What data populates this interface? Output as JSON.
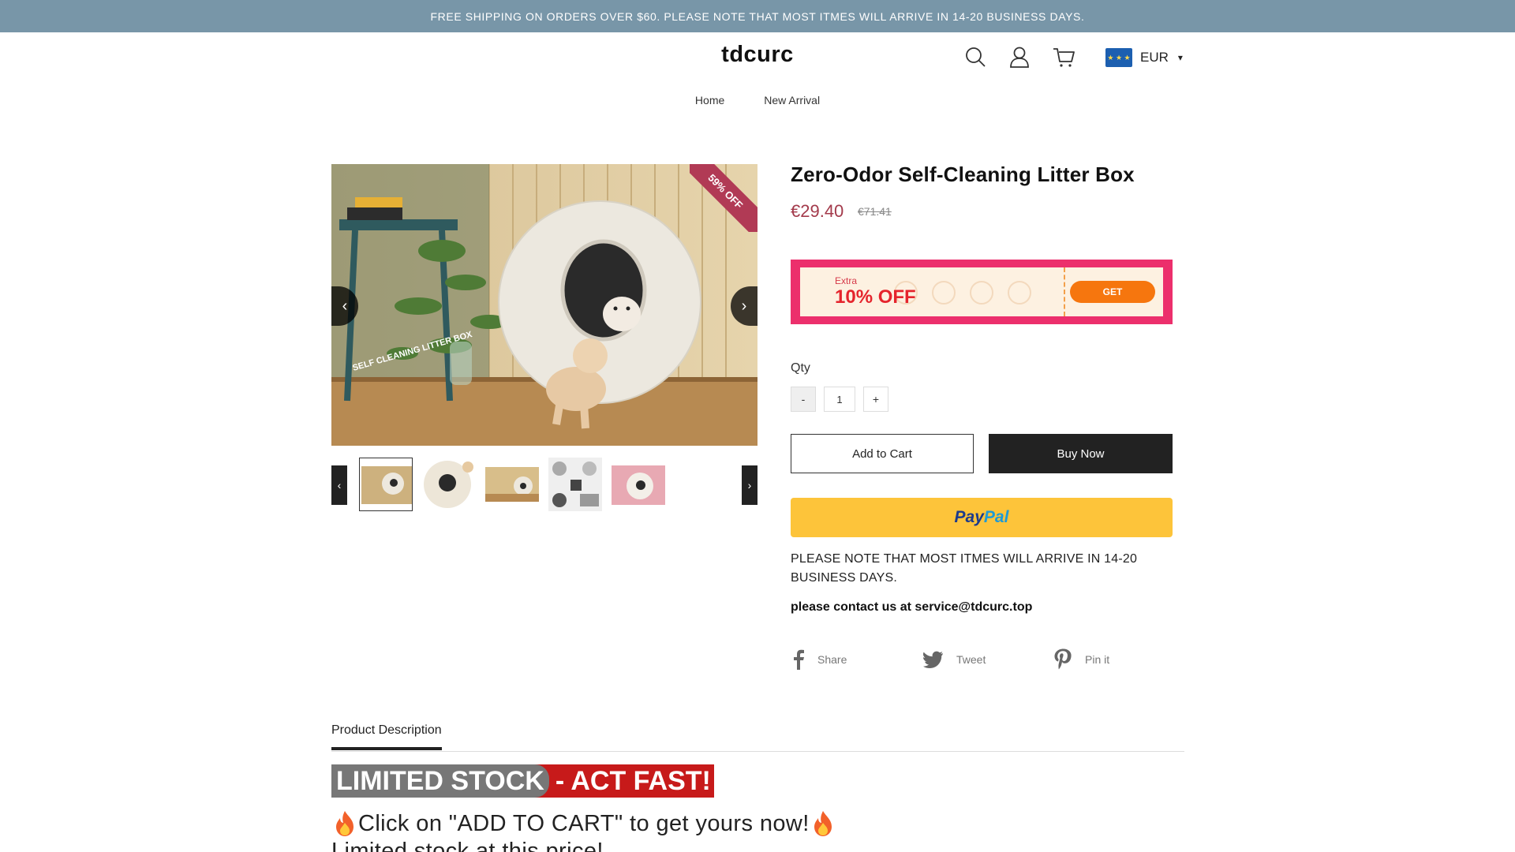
{
  "announcement": "FREE SHIPPING ON ORDERS OVER $60. PLEASE NOTE THAT MOST ITMES WILL ARRIVE IN 14-20 BUSINESS DAYS.",
  "header": {
    "logo": "tdcurc",
    "icons": [
      "search-icon",
      "user-icon",
      "cart-icon"
    ],
    "currency": {
      "label": "EUR",
      "flag": "eu-flag"
    }
  },
  "nav": {
    "items": [
      "Home",
      "New Arrival"
    ]
  },
  "product": {
    "title": "Zero-Odor Self-Cleaning Litter Box",
    "price": "€29.40",
    "compare_price": "€71.41",
    "badge": "59% OFF",
    "image_text": "SELF CLEANING LITTER BOX",
    "coupon": {
      "extra": "Extra",
      "discount": "10% OFF",
      "button": "GET"
    },
    "qty": {
      "label": "Qty",
      "minus": "-",
      "value": "1",
      "plus": "+"
    },
    "add_to_cart": "Add to Cart",
    "buy_now": "Buy Now",
    "paypal": {
      "part1": "Pay",
      "part2": "Pal"
    },
    "notice": "PLEASE NOTE THAT MOST ITMES WILL ARRIVE IN 14-20 BUSINESS DAYS.",
    "contact": "please contact us at service@tdcurc.top",
    "share": {
      "facebook": "Share",
      "twitter": "Tweet",
      "pinterest": "Pin it"
    }
  },
  "description": {
    "tab": "Product Description",
    "banner_part1": "LIMITED STOCK",
    "banner_part2": "- ACT FAST!",
    "line1": "Click on \"ADD TO CART\" to get yours now!",
    "line2": "Limited stock at this price!"
  },
  "colors": {
    "announcement_bg": "#7896a8",
    "price": "#a33a4b",
    "coupon_border": "#ec2f6c",
    "coupon_button": "#f6760e",
    "paypal_bg": "#fdc43a",
    "banner_red": "#c71a1a"
  }
}
